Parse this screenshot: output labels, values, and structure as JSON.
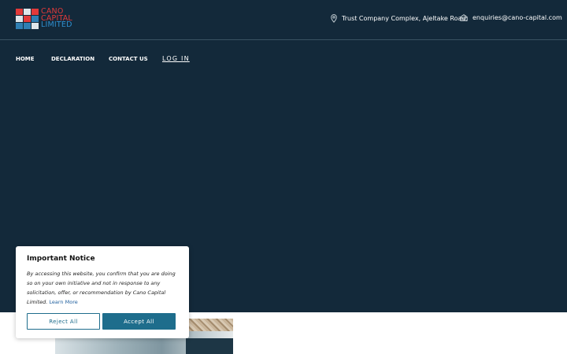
{
  "brand": {
    "logo_lines": [
      "CANO",
      "CAPITAL",
      "LIMITED"
    ],
    "logo_colors": [
      "#e23a3a",
      "#dfe6ea",
      "#e23a3a",
      "#dfe6ea",
      "#e23a3a",
      "#2f7fb3",
      "#2f7fb3",
      "#2f7fb3",
      "#dfe6ea"
    ],
    "text_colors": [
      "#e23a3a",
      "#e23a3a",
      "#2f8fcf"
    ]
  },
  "header": {
    "address_icon": "location-pin-icon",
    "address": "Trust Company Complex, Ajeltake Road,",
    "email_icon": "mail-icon",
    "email": "enquiries@cano-capital.com"
  },
  "nav": {
    "items": [
      "HOME",
      "DECLARATION",
      "CONTACT US"
    ],
    "login": "LOG IN"
  },
  "dialog": {
    "title": "Important Notice",
    "body": "By accessing this website, you confirm that you are doing so on your own initiative and not in response to any solicitation, offer, or recommendation by Cano Capital Limited.",
    "learn_more": "Learn More",
    "reject": "Reject All",
    "accept": "Accept All"
  },
  "colors": {
    "hero_bg": "#13293a",
    "accent": "#1e6d8c"
  }
}
